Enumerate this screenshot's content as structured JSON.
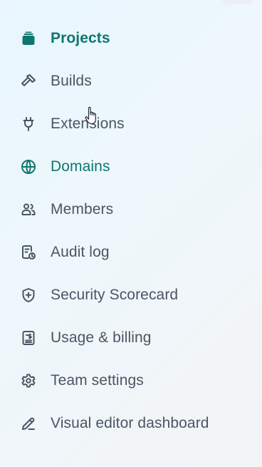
{
  "nav": {
    "items": [
      {
        "label": "Projects",
        "icon": "stacked-folders-icon"
      },
      {
        "label": "Builds",
        "icon": "hammer-icon"
      },
      {
        "label": "Extensions",
        "icon": "plug-icon"
      },
      {
        "label": "Domains",
        "icon": "globe-icon"
      },
      {
        "label": "Members",
        "icon": "members-icon"
      },
      {
        "label": "Audit log",
        "icon": "audit-log-icon"
      },
      {
        "label": "Security Scorecard",
        "icon": "shield-plus-icon"
      },
      {
        "label": "Usage & billing",
        "icon": "receipt-icon"
      },
      {
        "label": "Team settings",
        "icon": "gear-icon"
      },
      {
        "label": "Visual editor dashboard",
        "icon": "pencil-icon"
      }
    ]
  },
  "colors": {
    "active": "#0f766e",
    "text": "#4b5563",
    "icon": "#4b5563"
  }
}
